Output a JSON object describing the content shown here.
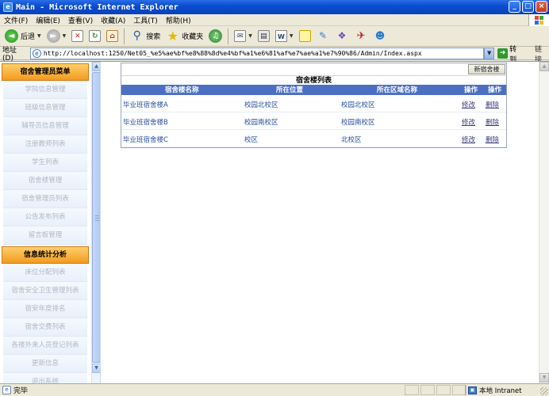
{
  "window": {
    "title": "Main - Microsoft Internet Explorer",
    "controls": [
      "_",
      "□",
      "×"
    ]
  },
  "menu": [
    "文件(F)",
    "编辑(E)",
    "查看(V)",
    "收藏(A)",
    "工具(T)",
    "帮助(H)"
  ],
  "toolbar": {
    "back_label": "后退",
    "search_label": "搜索",
    "favorites_label": "收藏夹"
  },
  "address": {
    "label": "地址(D)",
    "url": "http://localhost:1250/Net05_%e5%ae%bf%e8%88%8d%e4%bf%a1%e6%81%af%e7%ae%a1%e7%90%86/Admin/Index.aspx",
    "go_label": "转到",
    "links_label": "链接"
  },
  "sidebar": {
    "sections": [
      {
        "header": "宿舍管理员菜单",
        "items": [
          "学院信息管理",
          "班级信息管理",
          "辅导员信息管理",
          "注册教师列表",
          "学生列表",
          "宿舍楼管理",
          "宿舍管理员列表",
          "公告发布列表",
          "留言板管理"
        ]
      },
      {
        "header": "信息统计分析",
        "items": [
          "床位分配列表",
          "宿舍安全卫生管理列表",
          "宿安年度排名",
          "宿舍交费列表",
          "各楼外来人员登记列表",
          "更新信息",
          "退出系统"
        ]
      }
    ]
  },
  "panel": {
    "new_button": "新宿舍楼",
    "title": "宿舍楼列表",
    "columns": [
      "宿舍楼名称",
      "所在位置",
      "所在区域名称",
      "操作",
      "操作"
    ],
    "rows": [
      {
        "name": "毕业班宿舍楼A",
        "location": "校园北校区",
        "area": "校园北校区",
        "edit": "修改",
        "delete": "删除"
      },
      {
        "name": "毕业班宿舍楼B",
        "location": "校园南校区",
        "area": "校园南校区",
        "edit": "修改",
        "delete": "删除"
      },
      {
        "name": "毕业班宿舍楼C",
        "location": "校区",
        "area": "北校区",
        "edit": "修改",
        "delete": "删除"
      }
    ]
  },
  "status": {
    "text": "完毕",
    "zone": "本地 Intranet"
  },
  "colors": {
    "titlebar": "#0a4dd1",
    "menu_header": "#f29a1f",
    "grid_header": "#4d6fc2",
    "link_text": "#2a4f9c"
  }
}
